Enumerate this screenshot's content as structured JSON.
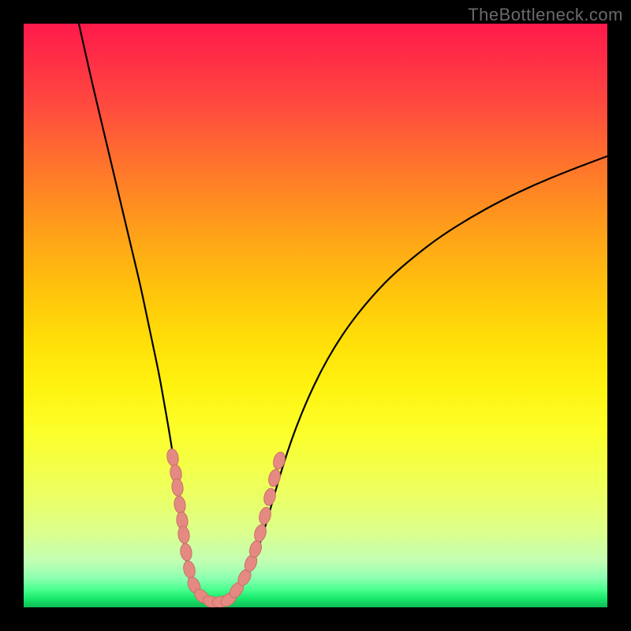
{
  "watermark": "TheBottleneck.com",
  "colors": {
    "frame": "#000000",
    "curve_stroke": "#000000",
    "marker_fill": "#e58a82",
    "marker_stroke": "#c96f66",
    "gradient_stops": [
      "#ff1a4b",
      "#ff2e46",
      "#ff4a3f",
      "#ff6b30",
      "#ff8a22",
      "#ffa916",
      "#ffc40c",
      "#ffde08",
      "#fff210",
      "#fcff2a",
      "#f3ff49",
      "#e9ff6a",
      "#dcff8c",
      "#c3ffb3",
      "#8cffb0",
      "#47ff8e",
      "#18e86a",
      "#0fbd55"
    ]
  },
  "chart_data": {
    "type": "line",
    "title": "",
    "xlabel": "",
    "ylabel": "",
    "xlim": [
      0,
      740
    ],
    "ylim_inverted": [
      0,
      740
    ],
    "series": [
      {
        "name": "bottleneck-curve-left",
        "stroke": "#000000",
        "points": [
          [
            70,
            0
          ],
          [
            78,
            36
          ],
          [
            88,
            80
          ],
          [
            98,
            122
          ],
          [
            108,
            164
          ],
          [
            118,
            206
          ],
          [
            128,
            248
          ],
          [
            138,
            290
          ],
          [
            148,
            332
          ],
          [
            156,
            370
          ],
          [
            164,
            408
          ],
          [
            172,
            446
          ],
          [
            178,
            480
          ],
          [
            184,
            514
          ],
          [
            189,
            545
          ],
          [
            193,
            575
          ],
          [
            197,
            605
          ],
          [
            200,
            632
          ],
          [
            203,
            658
          ],
          [
            206,
            680
          ],
          [
            210,
            700
          ],
          [
            216,
            716
          ],
          [
            224,
            727
          ],
          [
            234,
            733
          ],
          [
            244,
            735
          ]
        ]
      },
      {
        "name": "bottleneck-curve-right",
        "stroke": "#000000",
        "points": [
          [
            244,
            735
          ],
          [
            254,
            733
          ],
          [
            264,
            727
          ],
          [
            274,
            715
          ],
          [
            284,
            698
          ],
          [
            292,
            680
          ],
          [
            300,
            658
          ],
          [
            308,
            632
          ],
          [
            316,
            604
          ],
          [
            324,
            576
          ],
          [
            334,
            544
          ],
          [
            346,
            510
          ],
          [
            360,
            476
          ],
          [
            376,
            442
          ],
          [
            394,
            410
          ],
          [
            414,
            380
          ],
          [
            438,
            350
          ],
          [
            464,
            322
          ],
          [
            494,
            296
          ],
          [
            528,
            270
          ],
          [
            566,
            246
          ],
          [
            606,
            224
          ],
          [
            648,
            204
          ],
          [
            692,
            186
          ],
          [
            740,
            168
          ]
        ]
      }
    ],
    "markers": {
      "name": "highlighted-points",
      "fill": "#e58a82",
      "stroke": "#c96f66",
      "shape": "capsule",
      "rx": 7,
      "ry": 11,
      "points": [
        [
          189,
          550
        ],
        [
          193,
          570
        ],
        [
          195,
          588
        ],
        [
          198,
          610
        ],
        [
          201,
          630
        ],
        [
          203,
          648
        ],
        [
          206,
          670
        ],
        [
          210,
          692
        ],
        [
          216,
          712
        ],
        [
          226,
          726
        ],
        [
          238,
          733
        ],
        [
          250,
          733
        ],
        [
          260,
          730
        ],
        [
          270,
          718
        ],
        [
          280,
          702
        ],
        [
          288,
          684
        ],
        [
          294,
          666
        ],
        [
          300,
          646
        ],
        [
          306,
          624
        ],
        [
          312,
          600
        ],
        [
          318,
          576
        ],
        [
          324,
          554
        ]
      ]
    }
  }
}
